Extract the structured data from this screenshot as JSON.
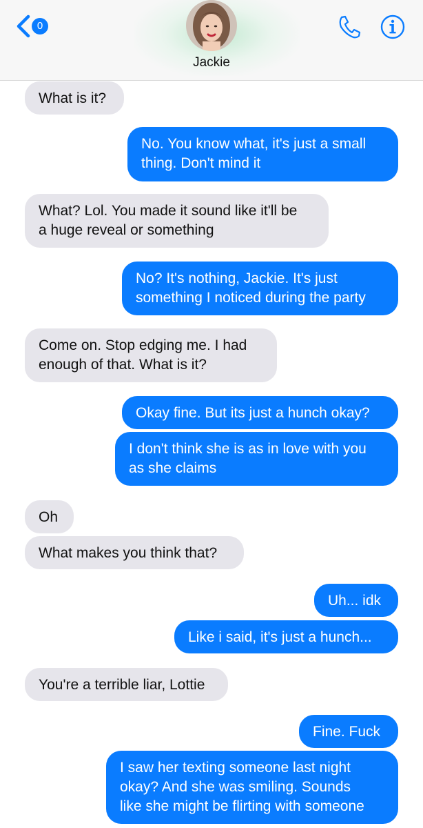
{
  "header": {
    "back_badge": "0",
    "contact_name": "Jackie"
  },
  "messages": [
    {
      "from": "contact",
      "text": "What is it?"
    },
    {
      "from": "me",
      "text": "No. You know what, it's just a small\nthing. Don't mind it"
    },
    {
      "from": "contact",
      "text": "What? Lol. You made it sound like it'll be\na huge reveal or something"
    },
    {
      "from": "me",
      "text": "No? It's nothing, Jackie. It's just\nsomething I noticed during the party"
    },
    {
      "from": "contact",
      "text": "Come on. Stop edging me. I had\nenough of that. What is it?"
    },
    {
      "from": "me",
      "text": "Okay fine. But its just a hunch okay?"
    },
    {
      "from": "me",
      "text": "I don't think she is as in love with you\nas she claims"
    },
    {
      "from": "contact",
      "text": "Oh"
    },
    {
      "from": "contact",
      "text": "What makes you think that?"
    },
    {
      "from": "me",
      "text": "Uh... idk"
    },
    {
      "from": "me",
      "text": "Like i said, it's just a hunch..."
    },
    {
      "from": "contact",
      "text": "You're a terrible liar, Lottie"
    },
    {
      "from": "me",
      "text": "Fine. Fuck"
    },
    {
      "from": "me",
      "text": "I saw her texting someone last night\nokay? And she was smiling. Sounds\nlike she might be flirting with someone"
    }
  ],
  "colors": {
    "sent_bubble": "#0a7cff",
    "received_bubble": "#e6e5eb",
    "accent": "#0a7cff"
  }
}
